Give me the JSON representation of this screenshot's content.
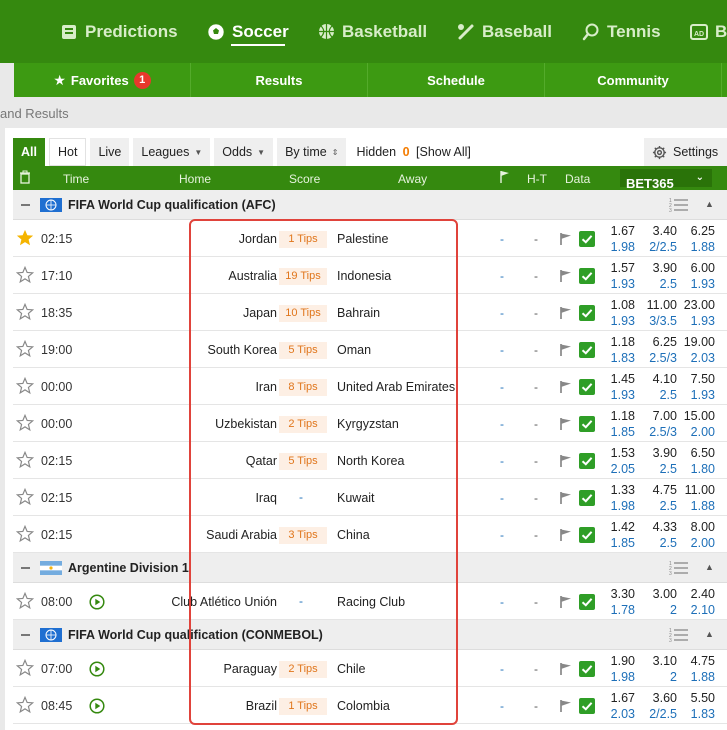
{
  "topnav": {
    "items": [
      {
        "label": "Predictions",
        "icon": "predictions-icon"
      },
      {
        "label": "Soccer",
        "icon": "soccer-ball-icon"
      },
      {
        "label": "Basketball",
        "icon": "basketball-icon"
      },
      {
        "label": "Baseball",
        "icon": "baseball-icon"
      },
      {
        "label": "Tennis",
        "icon": "tennis-icon"
      },
      {
        "label": "B",
        "icon": "ad-icon"
      }
    ],
    "active": "Soccer"
  },
  "subnav": {
    "favorites": "Favorites",
    "favorites_badge": "1",
    "results": "Results",
    "schedule": "Schedule",
    "community": "Community"
  },
  "breadcrumb": "and Results",
  "filters": {
    "all": "All",
    "hot": "Hot",
    "live": "Live",
    "leagues": "Leagues",
    "odds": "Odds",
    "bytime": "By time",
    "hidden_label": "Hidden",
    "hidden_count": "0",
    "show_all": "[Show All]",
    "settings": "Settings"
  },
  "columns": {
    "time": "Time",
    "home": "Home",
    "score": "Score",
    "away": "Away",
    "ht": "H-T",
    "data": "Data",
    "bookmaker": "BET365"
  },
  "leagues": [
    {
      "name": "FIFA World Cup qualification (AFC)"
    },
    {
      "name": "Argentine Division 1"
    },
    {
      "name": "FIFA World Cup qualification (CONMEBOL)"
    }
  ],
  "matches": [
    {
      "fav": true,
      "time": "02:15",
      "home": "Jordan",
      "tips": "1 Tips",
      "away": "Palestine",
      "fh": "-",
      "ht": "-",
      "o1": [
        "1.67",
        "1.98"
      ],
      "o2": [
        "3.40",
        "2/2.5"
      ],
      "o3": [
        "6.25",
        "1.88"
      ]
    },
    {
      "fav": false,
      "time": "17:10",
      "home": "Australia",
      "tips": "19 Tips",
      "away": "Indonesia",
      "fh": "-",
      "ht": "-",
      "o1": [
        "1.57",
        "1.93"
      ],
      "o2": [
        "3.90",
        "2.5"
      ],
      "o3": [
        "6.00",
        "1.93"
      ]
    },
    {
      "fav": false,
      "time": "18:35",
      "home": "Japan",
      "tips": "10 Tips",
      "away": "Bahrain",
      "fh": "-",
      "ht": "-",
      "o1": [
        "1.08",
        "1.93"
      ],
      "o2": [
        "11.00",
        "3/3.5"
      ],
      "o3": [
        "23.00",
        "1.93"
      ]
    },
    {
      "fav": false,
      "time": "19:00",
      "home": "South Korea",
      "tips": "5 Tips",
      "away": "Oman",
      "fh": "-",
      "ht": "-",
      "o1": [
        "1.18",
        "1.83"
      ],
      "o2": [
        "6.25",
        "2.5/3"
      ],
      "o3": [
        "19.00",
        "2.03"
      ]
    },
    {
      "fav": false,
      "time": "00:00",
      "home": "Iran",
      "tips": "8 Tips",
      "away": "United Arab Emirates",
      "fh": "-",
      "ht": "-",
      "o1": [
        "1.45",
        "1.93"
      ],
      "o2": [
        "4.10",
        "2.5"
      ],
      "o3": [
        "7.50",
        "1.93"
      ]
    },
    {
      "fav": false,
      "time": "00:00",
      "home": "Uzbekistan",
      "tips": "2 Tips",
      "away": "Kyrgyzstan",
      "fh": "-",
      "ht": "-",
      "o1": [
        "1.18",
        "1.85"
      ],
      "o2": [
        "7.00",
        "2.5/3"
      ],
      "o3": [
        "15.00",
        "2.00"
      ]
    },
    {
      "fav": false,
      "time": "02:15",
      "home": "Qatar",
      "tips": "5 Tips",
      "away": "North Korea",
      "fh": "-",
      "ht": "-",
      "o1": [
        "1.53",
        "2.05"
      ],
      "o2": [
        "3.90",
        "2.5"
      ],
      "o3": [
        "6.50",
        "1.80"
      ]
    },
    {
      "fav": false,
      "time": "02:15",
      "home": "Iraq",
      "tips": "-",
      "away": "Kuwait",
      "fh": "-",
      "ht": "-",
      "o1": [
        "1.33",
        "1.98"
      ],
      "o2": [
        "4.75",
        "2.5"
      ],
      "o3": [
        "11.00",
        "1.88"
      ]
    },
    {
      "fav": false,
      "time": "02:15",
      "home": "Saudi Arabia",
      "tips": "3 Tips",
      "away": "China",
      "fh": "-",
      "ht": "-",
      "o1": [
        "1.42",
        "1.85"
      ],
      "o2": [
        "4.33",
        "2.5"
      ],
      "o3": [
        "8.00",
        "2.00"
      ]
    },
    {
      "fav": false,
      "time": "08:00",
      "live": true,
      "home": "Club Atlético Unión",
      "tips": "-",
      "away": "Racing Club",
      "fh": "-",
      "ht": "-",
      "o1": [
        "3.30",
        "1.78"
      ],
      "o2": [
        "3.00",
        "2"
      ],
      "o3": [
        "2.40",
        "2.10"
      ]
    },
    {
      "fav": false,
      "time": "07:00",
      "live": true,
      "home": "Paraguay",
      "tips": "2 Tips",
      "away": "Chile",
      "fh": "-",
      "ht": "-",
      "o1": [
        "1.90",
        "1.98"
      ],
      "o2": [
        "3.10",
        "2"
      ],
      "o3": [
        "4.75",
        "1.88"
      ]
    },
    {
      "fav": false,
      "time": "08:45",
      "live": true,
      "home": "Brazil",
      "tips": "1 Tips",
      "away": "Colombia",
      "fh": "-",
      "ht": "-",
      "o1": [
        "1.67",
        "2.03"
      ],
      "o2": [
        "3.60",
        "2/2.5"
      ],
      "o3": [
        "5.50",
        "1.83"
      ]
    }
  ],
  "colors": {
    "primary": "#35890f",
    "accent_orange": "#f47c00",
    "link_blue": "#1d6fb8",
    "highlight_red": "#e0433b"
  }
}
